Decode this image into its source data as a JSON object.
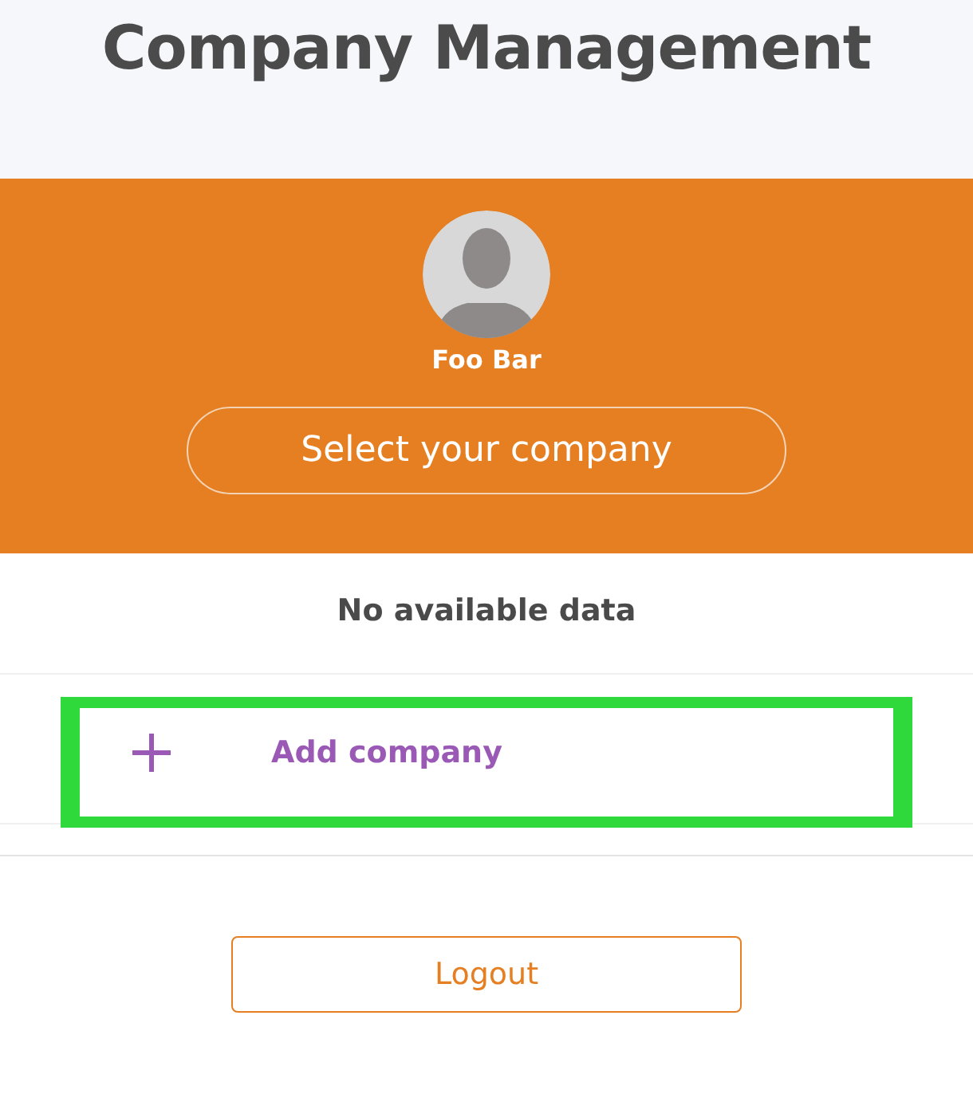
{
  "header": {
    "title": "Company Management"
  },
  "profile": {
    "name": "Foo Bar",
    "select_button": "Select your company"
  },
  "empty_message": "No available data",
  "add_company": {
    "label": "Add company",
    "highlighted": true
  },
  "logout_button": "Logout"
}
